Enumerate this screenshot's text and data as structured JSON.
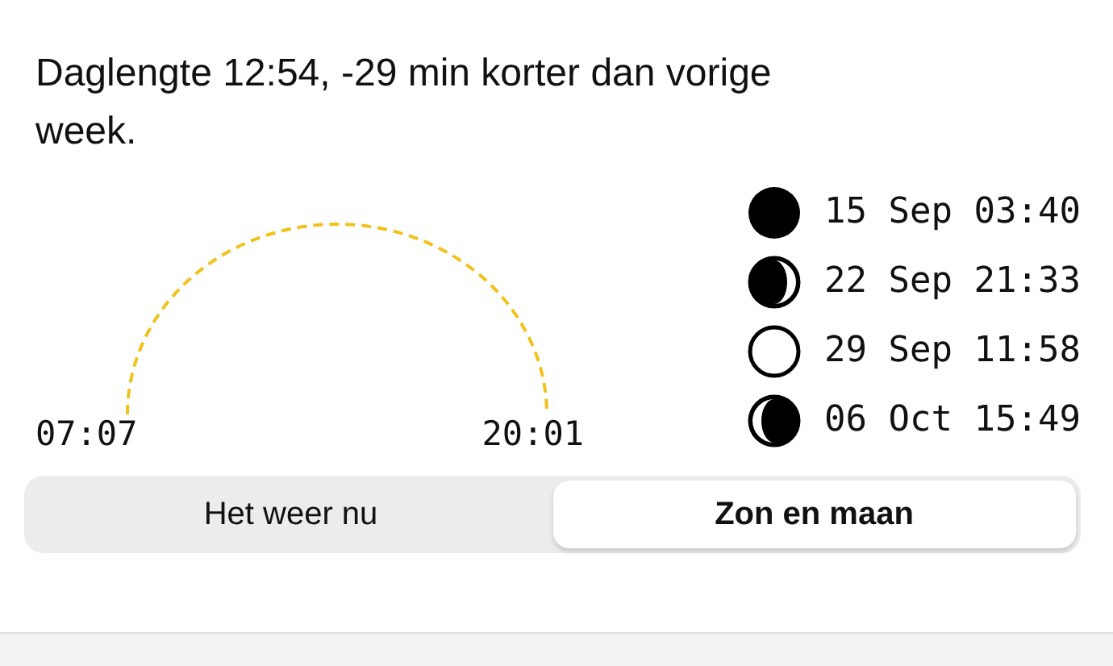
{
  "summary": "Daglengte 12:54, -29 min korter dan vorige week.",
  "sun": {
    "sunrise": "07:07",
    "sunset": "20:01"
  },
  "moon_phases": [
    {
      "kind": "new",
      "date": "15 Sep 03:40"
    },
    {
      "kind": "first_quarter",
      "date": "22 Sep 21:33"
    },
    {
      "kind": "full",
      "date": "29 Sep 11:58"
    },
    {
      "kind": "last_quarter",
      "date": "06 Oct 15:49"
    }
  ],
  "tabs": [
    {
      "label": "Het weer nu",
      "selected": false
    },
    {
      "label": "Zon en maan",
      "selected": true
    }
  ]
}
